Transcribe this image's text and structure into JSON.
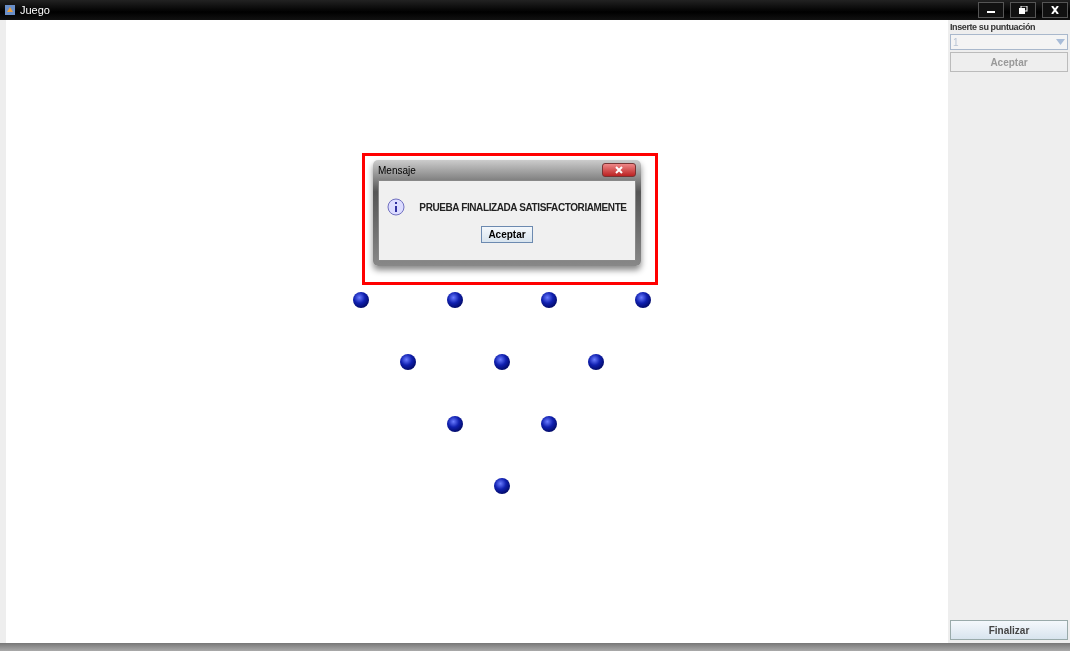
{
  "window": {
    "title": "Juego"
  },
  "side_panel": {
    "label": "Inserte su puntuación",
    "score_select": {
      "value": "1",
      "disabled": true
    },
    "accept_button": {
      "label": "Aceptar",
      "disabled": true
    },
    "finish_button": {
      "label": "Finalizar",
      "disabled": false
    }
  },
  "dialog": {
    "title": "Mensaje",
    "message": "PRUEBA FINALIZADA SATISFACTORIAMENTE",
    "button": "Aceptar",
    "highlighted": true
  }
}
